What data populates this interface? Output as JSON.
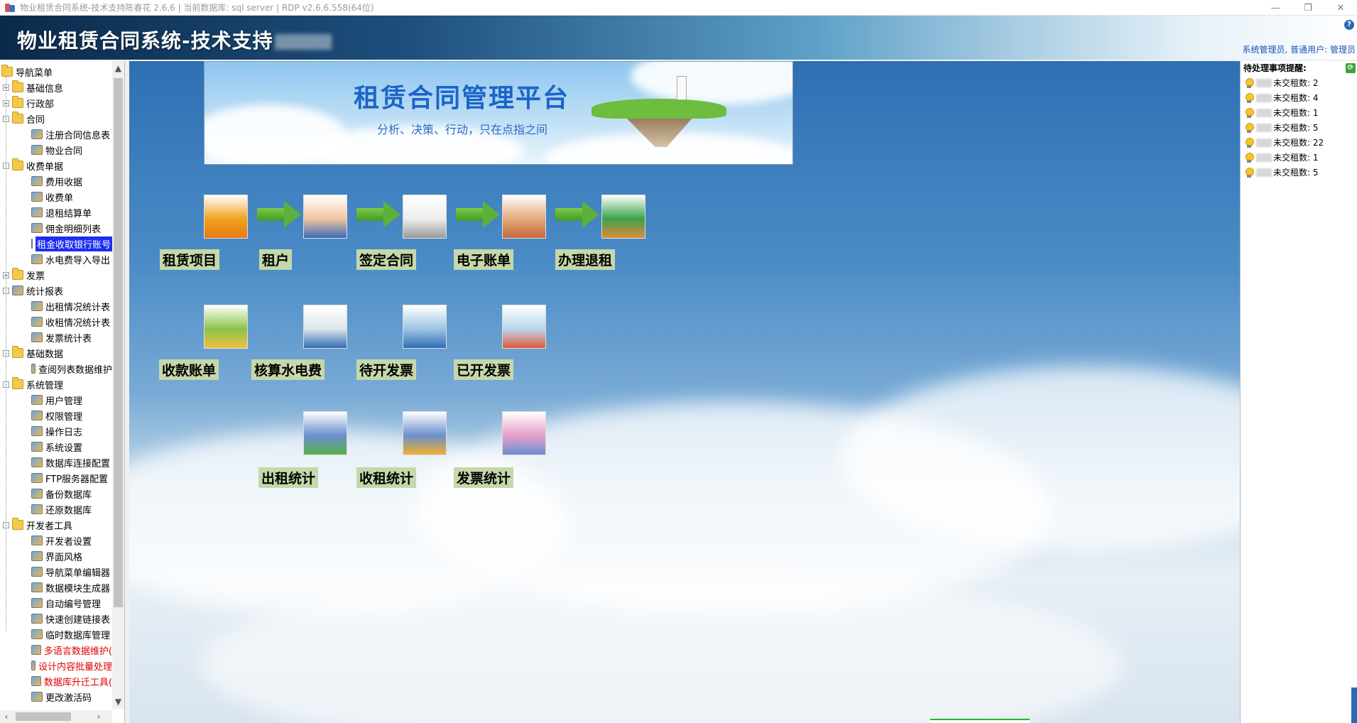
{
  "window": {
    "title": "物业租赁合同系统-技术支持陈春花 2.6.6 | 当前数据库: sql server | RDP v2.6.6.558(64位)",
    "controls": [
      "—",
      "❐",
      "✕"
    ]
  },
  "header": {
    "app_title": "物业租赁合同系统-技术支持",
    "help": "?",
    "user_info": "系统管理员, 普通用户: 管理员"
  },
  "nav": {
    "items": [
      {
        "label": "导航菜单",
        "level": 0,
        "icon": "folder-icon"
      },
      {
        "label": "基础信息",
        "level": 1,
        "icon": "folder-icon",
        "exp": "+"
      },
      {
        "label": "行政部",
        "level": 1,
        "icon": "folder-icon",
        "exp": "+"
      },
      {
        "label": "合同",
        "level": 1,
        "icon": "folder-icon",
        "exp": "-"
      },
      {
        "label": "注册合同信息表",
        "level": 2,
        "icon": "contract-icon"
      },
      {
        "label": "物业合同",
        "level": 2,
        "icon": "building-icon"
      },
      {
        "label": "收费单据",
        "level": 1,
        "icon": "folder-icon",
        "exp": "-"
      },
      {
        "label": "费用收据",
        "level": 2,
        "icon": "pen-icon"
      },
      {
        "label": "收费单",
        "level": 2,
        "icon": "form-icon"
      },
      {
        "label": "退租结算单",
        "level": 2,
        "icon": "bill-icon"
      },
      {
        "label": "佣金明细列表",
        "level": 2,
        "icon": "list-icon"
      },
      {
        "label": "租金收取银行账号",
        "level": 2,
        "icon": "bank-icon",
        "selected": true
      },
      {
        "label": "水电费导入导出",
        "level": 2,
        "icon": "bill-icon"
      },
      {
        "label": "发票",
        "level": 1,
        "icon": "folder-icon",
        "exp": "+"
      },
      {
        "label": "统计报表",
        "level": 1,
        "icon": "report-icon",
        "exp": "-"
      },
      {
        "label": "出租情况统计表",
        "level": 2,
        "icon": "coin-icon"
      },
      {
        "label": "收租情况统计表",
        "level": 2,
        "icon": "coin-icon"
      },
      {
        "label": "发票统计表",
        "level": 2,
        "icon": "invoice-icon"
      },
      {
        "label": "基础数据",
        "level": 1,
        "icon": "folder-icon",
        "exp": "-"
      },
      {
        "label": "查阅列表数据维护",
        "level": 2,
        "icon": "grid-icon"
      },
      {
        "label": "系统管理",
        "level": 1,
        "icon": "folder-icon",
        "exp": "-"
      },
      {
        "label": "用户管理",
        "level": 2,
        "icon": "users-icon"
      },
      {
        "label": "权限管理",
        "level": 2,
        "icon": "lock-icon"
      },
      {
        "label": "操作日志",
        "level": 2,
        "icon": "log-icon"
      },
      {
        "label": "系统设置",
        "level": 2,
        "icon": "settings-icon"
      },
      {
        "label": "数据库连接配置",
        "level": 2,
        "icon": "database-icon"
      },
      {
        "label": "FTP服务器配置",
        "level": 2,
        "icon": "ftp-icon"
      },
      {
        "label": "备份数据库",
        "level": 2,
        "icon": "database-icon"
      },
      {
        "label": "还原数据库",
        "level": 2,
        "icon": "restore-icon"
      },
      {
        "label": "开发者工具",
        "level": 1,
        "icon": "folder-icon",
        "exp": "-"
      },
      {
        "label": "开发者设置",
        "level": 2,
        "icon": "gear-icon"
      },
      {
        "label": "界面风格",
        "level": 2,
        "icon": "palette-icon"
      },
      {
        "label": "导航菜单编辑器",
        "level": 2,
        "icon": "edit-icon"
      },
      {
        "label": "数据模块生成器",
        "level": 2,
        "icon": "wand-icon"
      },
      {
        "label": "自动编号管理",
        "level": 2,
        "icon": "numbering-icon"
      },
      {
        "label": "快速创建链接表",
        "level": 2,
        "icon": "link-icon"
      },
      {
        "label": "临时数据库管理",
        "level": 2,
        "icon": "edit-icon"
      },
      {
        "label": "多语言数据维护(",
        "level": 2,
        "icon": "language-icon",
        "red": true
      },
      {
        "label": "设计内容批量处理",
        "level": 2,
        "icon": "edit-icon",
        "red": true
      },
      {
        "label": "数据库升迁工具(",
        "level": 2,
        "icon": "wand-icon",
        "red": true
      },
      {
        "label": "更改激活码",
        "level": 2,
        "icon": "key-icon"
      }
    ]
  },
  "banner": {
    "title": "租赁合同管理平台",
    "subtitle": "分析、决策、行动，只在点指之间"
  },
  "tiles": [
    {
      "name": "tile-rental-project",
      "label": "租赁项目",
      "icon": "apartment-building-icon"
    },
    {
      "name": "tile-tenant",
      "label": "租户",
      "icon": "tenant-avatar-icon"
    },
    {
      "name": "tile-sign-contract",
      "label": "签定合同",
      "icon": "contract-sign-icon"
    },
    {
      "name": "tile-e-bill",
      "label": "电子账单",
      "icon": "e-bill-icon"
    },
    {
      "name": "tile-checkout",
      "label": "办理退租",
      "icon": "gavel-house-icon"
    },
    {
      "name": "tile-receipt",
      "label": "收款账单",
      "icon": "receipt-house-icon"
    },
    {
      "name": "tile-utilities",
      "label": "核算水电费",
      "icon": "utilities-icon"
    },
    {
      "name": "tile-pending-invoice",
      "label": "待开发票",
      "icon": "search-house-icon"
    },
    {
      "name": "tile-issued-invoice",
      "label": "已开发票",
      "icon": "issued-invoice-icon"
    },
    {
      "name": "tile-rental-stats",
      "label": "出租统计",
      "icon": "rental-stats-icon"
    },
    {
      "name": "tile-collection-stats",
      "label": "收租统计",
      "icon": "collection-stats-icon"
    },
    {
      "name": "tile-invoice-stats",
      "label": "发票统计",
      "icon": "invoice-stats-icon"
    }
  ],
  "reminders": {
    "title": "待处理事项提醒:",
    "items": [
      {
        "text": "未交租数: 2"
      },
      {
        "text": "未交租数: 4"
      },
      {
        "text": "未交租数: 1"
      },
      {
        "text": "未交租数: 5"
      },
      {
        "text": "未交租数: 22"
      },
      {
        "text": "未交租数: 1"
      },
      {
        "text": "未交租数: 5"
      }
    ]
  }
}
